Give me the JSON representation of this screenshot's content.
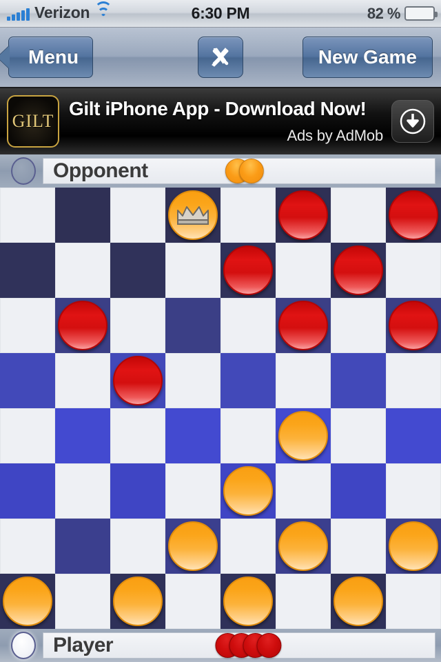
{
  "status_bar": {
    "carrier": "Verizon",
    "time": "6:30 PM",
    "battery_percent": "82 %",
    "signal_icon": "cellular-signal-icon",
    "wifi_icon": "wifi-icon",
    "battery_icon": "battery-icon"
  },
  "nav_bar": {
    "back_label": "Menu",
    "tools_icon": "tools-hammer-wrench-icon",
    "new_game_label": "New Game"
  },
  "ad": {
    "logo_text": "GILT",
    "title": "Gilt iPhone App - Download Now!",
    "attribution": "Ads by AdMob",
    "cta_icon": "download-arrow-icon"
  },
  "opponent": {
    "label": "Opponent",
    "turn_active": false,
    "captured_count": 2,
    "captured_color": "#fb9c17"
  },
  "player": {
    "label": "Player",
    "turn_active": true,
    "captured_count": 4,
    "captured_color": "#cf0d0d"
  },
  "board": {
    "size": 8,
    "light_square_color": "#eef0f4",
    "dark_square_colors": [
      "#2f3055",
      "#30325a",
      "#3b3f86",
      "#4249b9",
      "#434ad0",
      "#3f45c4",
      "#3b3f8e",
      "#2f3159"
    ],
    "red_piece_color": "#d40f0f",
    "orange_piece_color": "#fba51a",
    "king_icon": "crown-icon",
    "cells": [
      [
        null,
        null,
        null,
        "orange-king",
        null,
        "red",
        null,
        "red"
      ],
      [
        null,
        null,
        null,
        null,
        "red",
        null,
        "red",
        null
      ],
      [
        null,
        "red",
        null,
        null,
        null,
        "red",
        null,
        "red"
      ],
      [
        null,
        null,
        "red",
        null,
        null,
        null,
        null,
        null
      ],
      [
        null,
        null,
        null,
        null,
        null,
        "orange",
        null,
        null
      ],
      [
        null,
        null,
        null,
        null,
        "orange",
        null,
        null,
        null
      ],
      [
        null,
        null,
        null,
        "orange",
        null,
        "orange",
        null,
        "orange"
      ],
      [
        "orange",
        null,
        "orange",
        null,
        "orange",
        null,
        "orange",
        null
      ]
    ]
  }
}
